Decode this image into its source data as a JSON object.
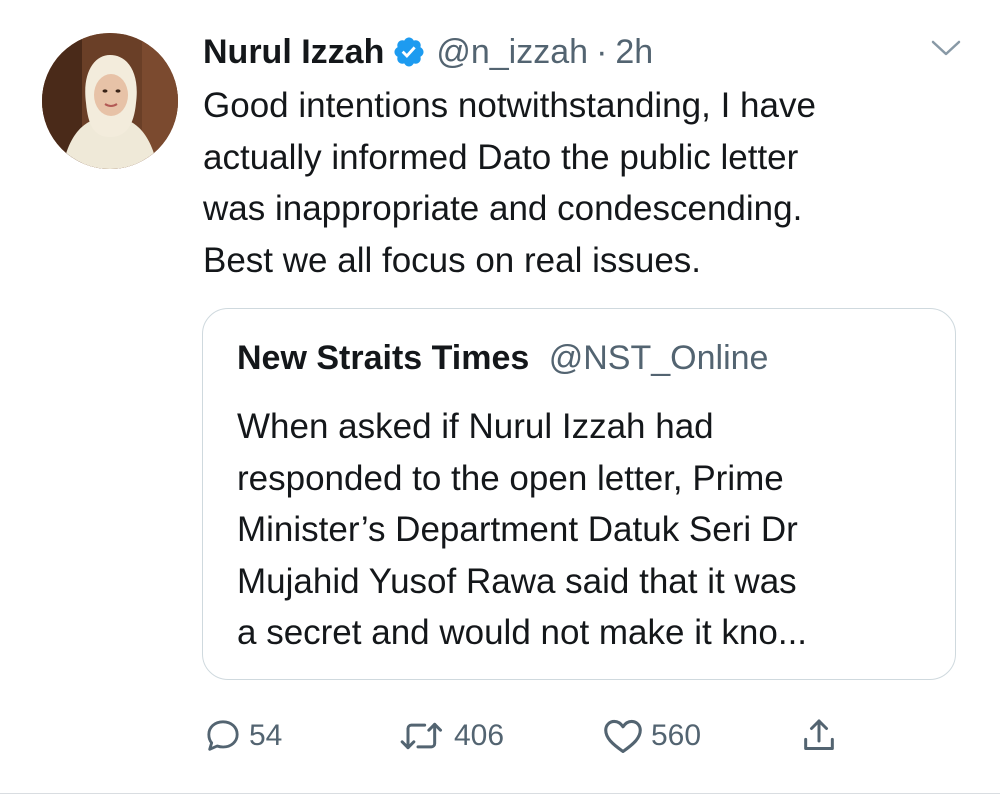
{
  "author": {
    "display_name": "Nurul Izzah",
    "handle": "@n_izzah",
    "separator": "·",
    "timestamp": "2h",
    "verified": true,
    "avatar_icon": "profile-photo"
  },
  "tweet": {
    "text": "Good intentions notwithstanding, I have\nactually informed Dato the public letter\nwas inappropriate and condescending.\nBest we all focus on real issues."
  },
  "quoted_tweet": {
    "display_name": "New Straits Times",
    "handle": "@NST_Online",
    "text": "When asked if Nurul Izzah had\nresponded to the open letter, Prime\nMinister’s Department Datuk Seri Dr\nMujahid Yusof Rawa  said that it was\na secret and would not make it kno..."
  },
  "actions": {
    "reply_count": "54",
    "retweet_count": "406",
    "like_count": "560",
    "icons": [
      "reply-icon",
      "retweet-icon",
      "like-icon",
      "share-icon"
    ]
  },
  "colors": {
    "text_primary": "#14171a",
    "text_secondary": "#536471",
    "verified_blue": "#1d9bf0",
    "border": "#cfd9de"
  }
}
